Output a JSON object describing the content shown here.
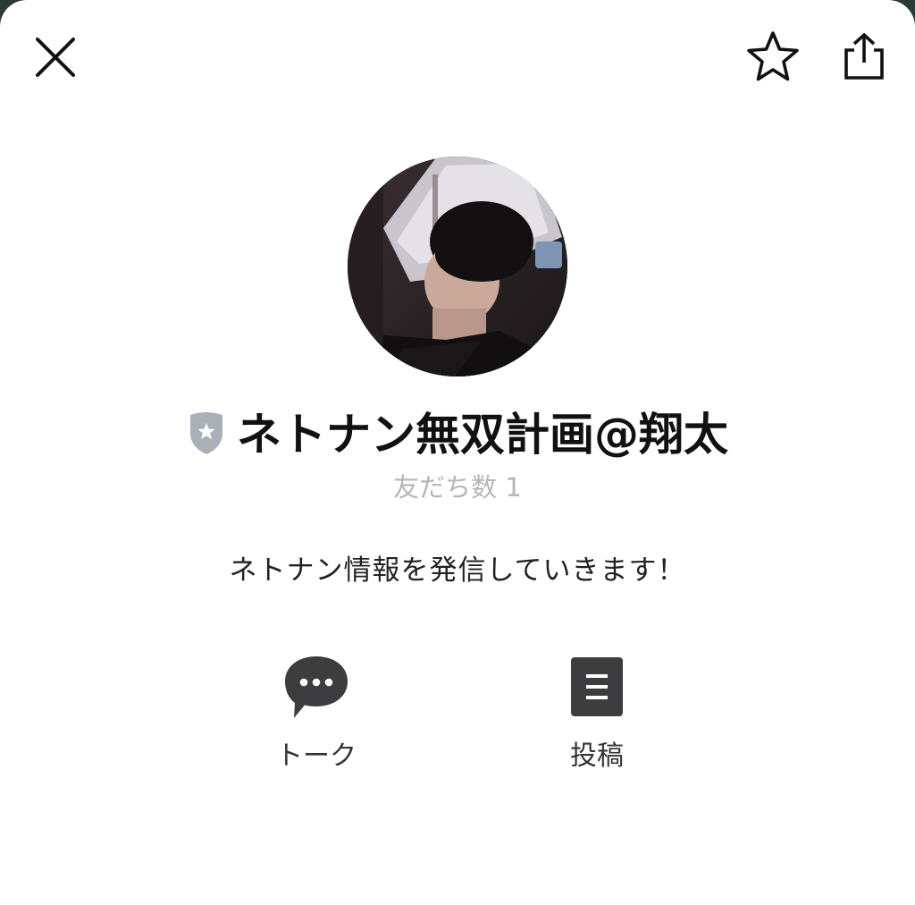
{
  "header": {
    "close_icon": "close-icon",
    "favorite_icon": "star-outline-icon",
    "share_icon": "share-icon"
  },
  "profile": {
    "badge_icon": "verified-shield-icon",
    "badge_color": "#aab0b8",
    "name": "ネトナン無双計画@翔太",
    "friends": "友だち数 1",
    "description": "ネトナン情報を発信していきます！"
  },
  "actions": [
    {
      "icon": "chat-bubble-icon",
      "label": "トーク"
    },
    {
      "icon": "post-list-icon",
      "label": "投稿"
    }
  ],
  "colors": {
    "background": "#ffffff",
    "text_primary": "#111111",
    "text_muted": "#b6b6b6",
    "icon_dark": "#3d3d40"
  }
}
